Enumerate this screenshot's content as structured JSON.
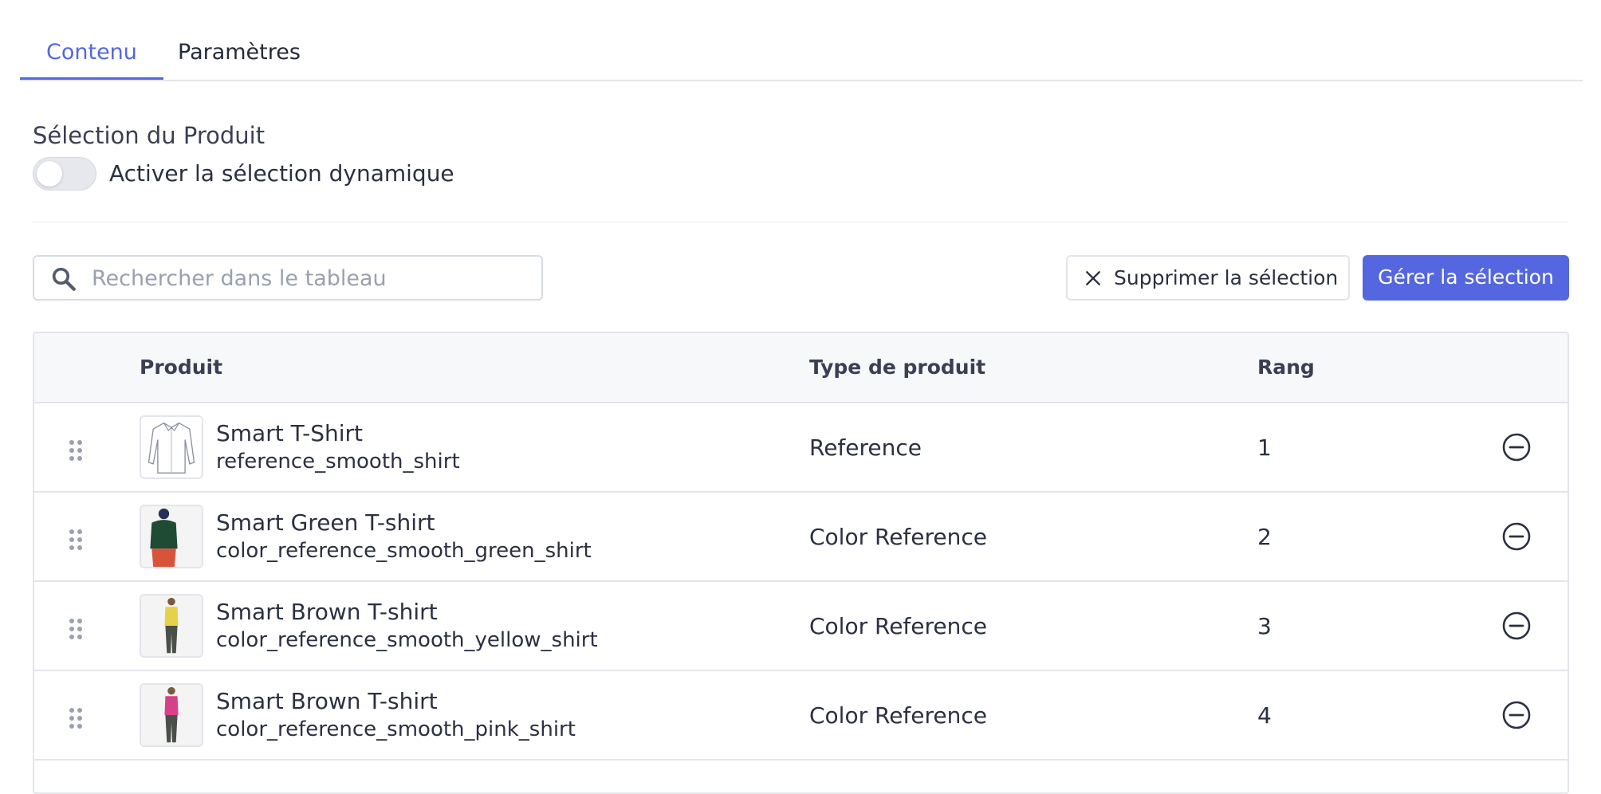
{
  "tabs": [
    {
      "label": "Contenu",
      "active": true
    },
    {
      "label": "Paramètres",
      "active": false
    }
  ],
  "section": {
    "title": "Sélection du Produit",
    "toggle_label": "Activer la sélection dynamique",
    "toggle_on": false
  },
  "toolbar": {
    "search_placeholder": "Rechercher dans le tableau",
    "search_value": "",
    "remove_selection_label": "Supprimer la sélection",
    "manage_selection_label": "Gérer la sélection"
  },
  "table": {
    "headers": {
      "product": "Produit",
      "type": "Type de produit",
      "rank": "Rang"
    },
    "rows": [
      {
        "name": "Smart T-Shirt",
        "code": "reference_smooth_shirt",
        "type": "Reference",
        "rank": "1"
      },
      {
        "name": "Smart Green T-shirt",
        "code": "color_reference_smooth_green_shirt",
        "type": "Color Reference",
        "rank": "2"
      },
      {
        "name": "Smart Brown T-shirt",
        "code": "color_reference_smooth_yellow_shirt",
        "type": "Color Reference",
        "rank": "3"
      },
      {
        "name": "Smart Brown T-shirt",
        "code": "color_reference_smooth_pink_shirt",
        "type": "Color Reference",
        "rank": "4"
      }
    ]
  },
  "icons": {
    "search": "search-icon",
    "close": "close-icon",
    "drag": "drag-handle-icon",
    "remove": "minus-circle-icon"
  },
  "colors": {
    "accent": "#5467e0",
    "text": "#2b3042",
    "border": "#e3e5eb"
  }
}
